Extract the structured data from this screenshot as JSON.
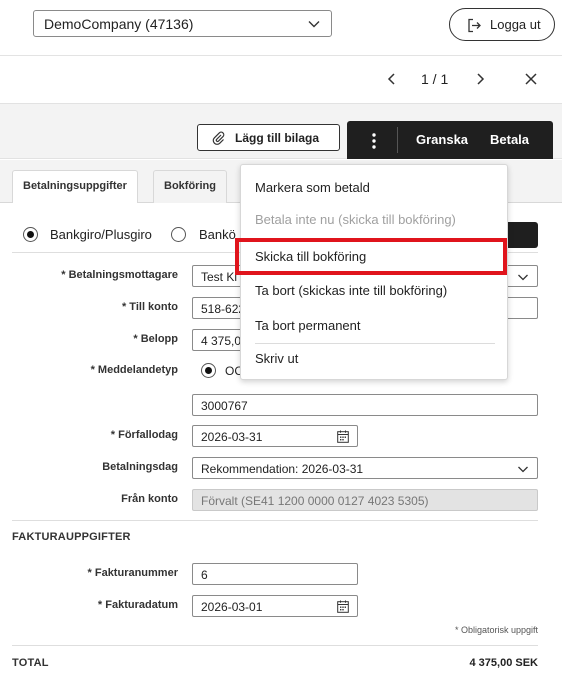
{
  "header": {
    "company_select": "DemoCompany (47136)",
    "logout_label": "Logga ut"
  },
  "pager": {
    "count": "1 / 1"
  },
  "toolbar": {
    "attach_label": "Lägg till bilaga",
    "review_label": "Granska",
    "pay_label": "Betala"
  },
  "tabs": [
    {
      "label": "Betalningsuppgifter",
      "active": true
    },
    {
      "label": "Bokföring",
      "active": false
    }
  ],
  "payment": {
    "method_1": "Bankgiro/Plusgiro",
    "method_2": "Bankö",
    "recipient_label": "* Betalningsmottagare",
    "recipient_value": "Test Ki",
    "to_account_label": "* Till konto",
    "to_account_value": "518-622",
    "amount_label": "* Belopp",
    "amount_value": "4 375,00",
    "message_type_label": "* Meddelandetyp",
    "message_type_value": "OC",
    "message_value": "3000767",
    "due_date_label": "* Förfallodag",
    "due_date_value": "2026-03-31",
    "pay_date_label": "Betalningsdag",
    "pay_date_value": "Rekommendation: 2026-03-31",
    "from_account_label": "Från konto",
    "from_account_value": "Förvalt (SE41 1200 0000 0127 4023 5305)"
  },
  "invoice": {
    "section_title": "FAKTURAUPPGIFTER",
    "number_label": "* Fakturanummer",
    "number_value": "6",
    "date_label": "* Fakturadatum",
    "date_value": "2026-03-01",
    "required_note": "* Obligatorisk uppgift"
  },
  "total": {
    "label": "TOTAL",
    "value": "4 375,00 SEK"
  },
  "menu": {
    "items": [
      {
        "label": "Markera som betald"
      },
      {
        "label": "Betala inte nu (skicka till bokföring)",
        "disabled": true
      },
      {
        "label": "Skicka till bokföring",
        "highlighted": true
      },
      {
        "label": "Ta bort (skickas inte till bokföring)"
      },
      {
        "label": "Ta bort permanent"
      },
      {
        "label": "Skriv ut"
      }
    ]
  },
  "colors": {
    "accent_dark": "#1f1f1f",
    "highlight": "#e0141c"
  },
  "icons": [
    "chevron-down-icon",
    "logout-icon",
    "chevron-left-icon",
    "chevron-right-icon",
    "close-icon",
    "paperclip-icon",
    "more-vertical-icon",
    "calendar-icon"
  ]
}
